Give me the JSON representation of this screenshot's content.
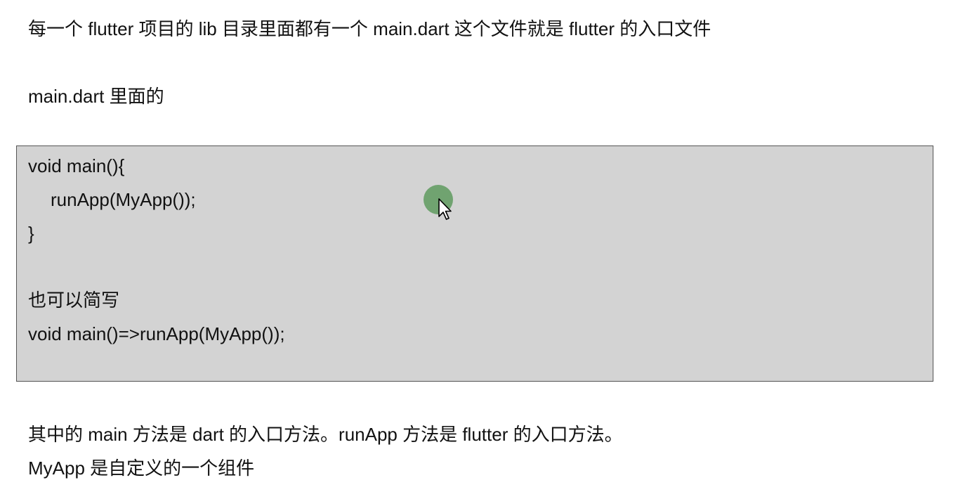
{
  "intro": "每一个 flutter 项目的 lib 目录里面都有一个 main.dart 这个文件就是 flutter 的入口文件",
  "subheading": "main.dart 里面的",
  "code_block": {
    "lines": [
      "void main(){",
      "runApp(MyApp());",
      "}",
      "也可以简写",
      "void main()=>runApp(MyApp());"
    ]
  },
  "notes": [
    "其中的 main 方法是 dart 的入口方法。runApp 方法是 flutter 的入口方法。",
    "MyApp 是自定义的一个组件"
  ],
  "colors": {
    "code_background": "#d3d3d3",
    "cursor_highlight": "#6aa06a"
  },
  "icons": {
    "cursor": "mouse-pointer-icon"
  }
}
